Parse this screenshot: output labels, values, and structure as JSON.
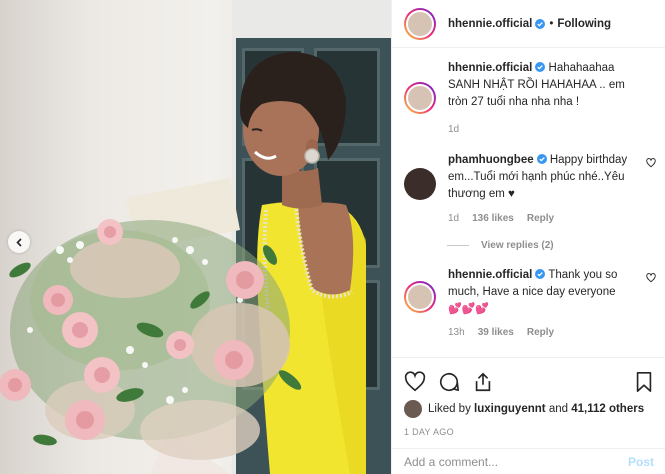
{
  "header": {
    "username": "hhennie.official",
    "separator": "•",
    "follow_label": "Following"
  },
  "caption": {
    "username": "hhennie.official",
    "text": "Hahahaahaa SANH NHẬT RỒI HAHAHAA .. em tròn 27 tuổi nha nha nha !",
    "time": "1d"
  },
  "comments": [
    {
      "username": "phamhuongbee",
      "text": "Happy birthday em...Tuổi mới hạnh phúc nhé..Yêu thương em ♥",
      "time": "1d",
      "likes": "136 likes",
      "reply": "Reply",
      "view_replies": "View replies (2)"
    },
    {
      "username": "hhennie.official",
      "text": "Thank you so much, Have a nice day everyone",
      "emojis": "💕💕💕",
      "time": "13h",
      "likes": "39 likes",
      "reply": "Reply"
    }
  ],
  "likes": {
    "prefix": "Liked by",
    "user": "luxinguyennt",
    "joiner": "and",
    "count": "41,112 others"
  },
  "posted": "1 DAY AGO",
  "add_comment": {
    "placeholder": "Add a comment...",
    "post_label": "Post"
  },
  "colors": {
    "verified": "#3897f0",
    "post_disabled": "#b2dffc",
    "dress": "#f2e530"
  }
}
